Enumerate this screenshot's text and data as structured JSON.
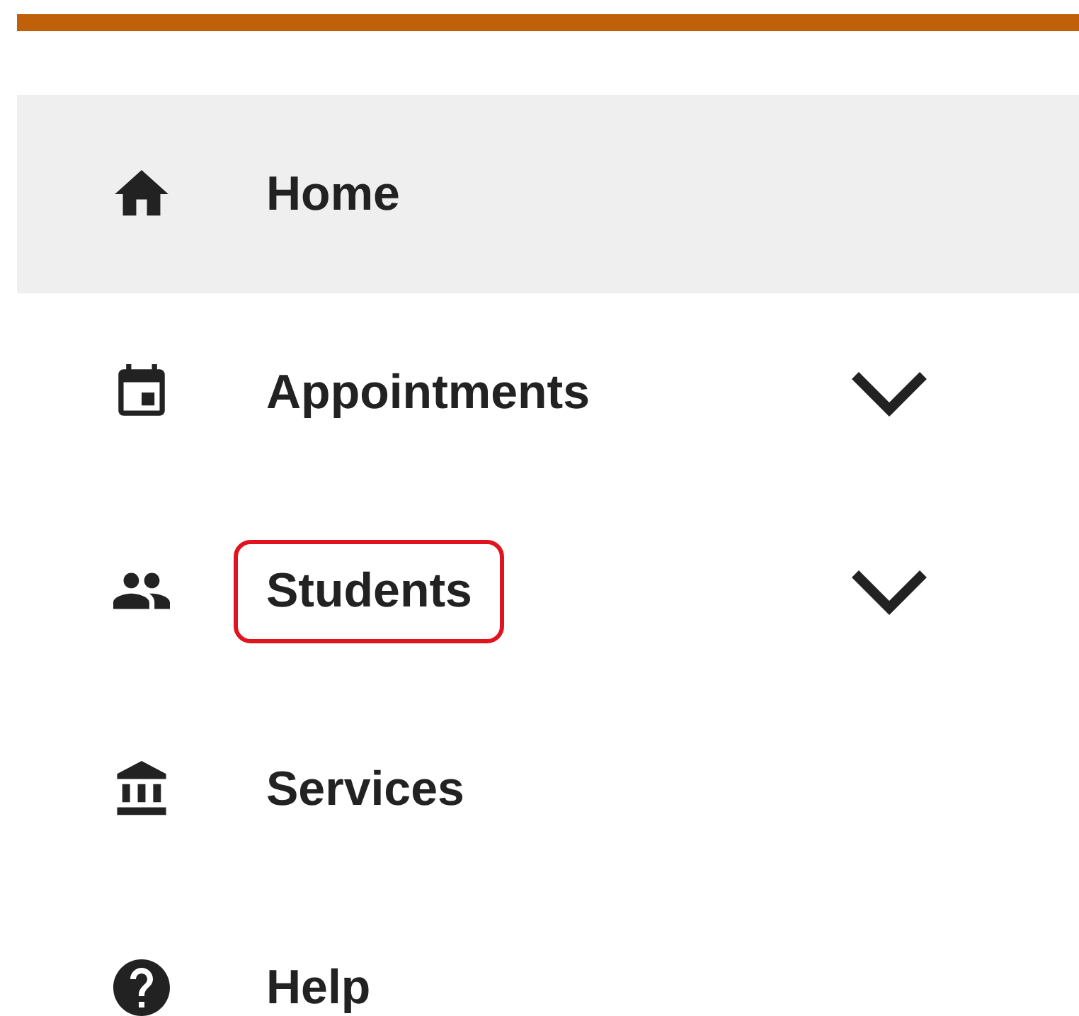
{
  "menu": [
    {
      "label": "Home",
      "selected": true,
      "has_submenu": false,
      "highlighted": false
    },
    {
      "label": "Appointments",
      "selected": false,
      "has_submenu": true,
      "highlighted": false
    },
    {
      "label": "Students",
      "selected": false,
      "has_submenu": true,
      "highlighted": true
    },
    {
      "label": "Services",
      "selected": false,
      "has_submenu": false,
      "highlighted": false
    },
    {
      "label": "Help",
      "selected": false,
      "has_submenu": false,
      "highlighted": false
    }
  ]
}
